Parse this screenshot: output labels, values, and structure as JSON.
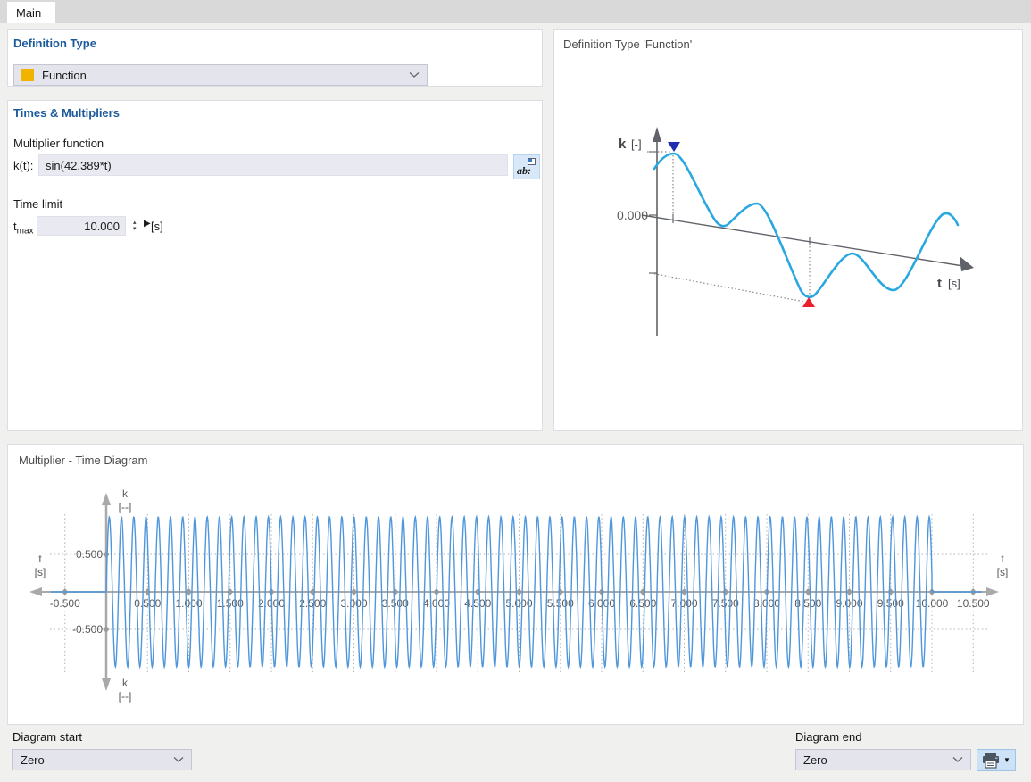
{
  "tabs": {
    "main": "Main"
  },
  "definition_type": {
    "header": "Definition Type",
    "selected": "Function",
    "swatch_color": "#f0b400"
  },
  "times_multipliers": {
    "header": "Times & Multipliers",
    "multiplier_function_label": "Multiplier function",
    "kt_label": "k(t):",
    "kt_value": "sin(42.389*t)",
    "edit_button_glyph": "ab:",
    "time_limit_label": "Time limit",
    "tmax_base": "t",
    "tmax_sub": "max",
    "tmax_value": "10.000",
    "tmax_unit": "[s]",
    "spin_up": "▴",
    "spin_down": "▾",
    "play_glyph": "▶"
  },
  "preview": {
    "title": "Definition Type 'Function'",
    "k_label": "k",
    "k_unit": "[-]",
    "t_label": "t",
    "t_unit": "[s]",
    "zero_label": "0.000",
    "curve_color": "#29a8e0",
    "max_marker_color": "#1f2db0",
    "min_marker_color": "#e8212d"
  },
  "diagram": {
    "title": "Multiplier - Time Diagram",
    "k_label": "k",
    "k_unit": "[--]",
    "t_label": "t",
    "t_unit": "[s]"
  },
  "chart_data": {
    "type": "line",
    "title": "Multiplier - Time Diagram",
    "function": "k(t) = sin(42.389*t)",
    "amplitude": 1,
    "omega": 42.389,
    "t_start": 0,
    "t_end": 10,
    "flat_before_start": -0.67,
    "flat_after_end": 10.6,
    "xlabel": "t [s]",
    "ylabel": "k [--]",
    "xlim": [
      -0.75,
      10.75
    ],
    "ylim": [
      -1,
      1
    ],
    "grid": true,
    "t_axis_ticks": [
      -0.5,
      0.5,
      1,
      1.5,
      2,
      2.5,
      3,
      3.5,
      4,
      4.5,
      5,
      5.5,
      6,
      6.5,
      7,
      7.5,
      8,
      8.5,
      9,
      9.5,
      10,
      10.5
    ],
    "k_axis_ticks": [
      0.5,
      -0.5
    ],
    "tick_decimals": 3,
    "line_color": "#4f97dc",
    "axis_color": "#a9a9a9",
    "grid_color": "#b4b4b4",
    "text_color": "#595959"
  },
  "footer": {
    "diagram_start_label": "Diagram start",
    "diagram_start_value": "Zero",
    "diagram_end_label": "Diagram end",
    "diagram_end_value": "Zero"
  }
}
